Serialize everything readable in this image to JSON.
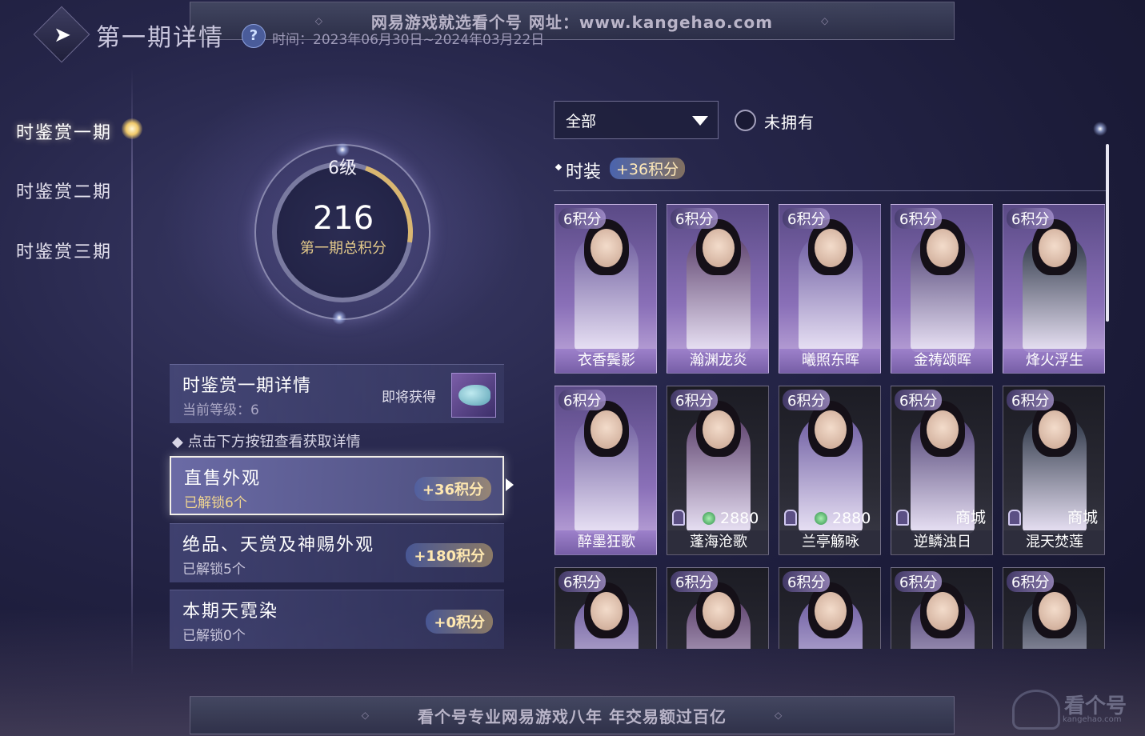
{
  "header": {
    "title": "第一期详情",
    "time_text": "时间：2023年06月30日~2024年03月22日",
    "help": "?"
  },
  "watermark": {
    "top_text": "网易游戏就选看个号  网址：www.kangehao.com",
    "bottom_text": "看个号专业网易游戏八年  年交易额过百亿",
    "logo_text": "看个号",
    "logo_sub": "kangehao.com"
  },
  "nav": {
    "items": [
      {
        "label": "时鉴赏一期",
        "active": true
      },
      {
        "label": "时鉴赏二期",
        "active": false
      },
      {
        "label": "时鉴赏三期",
        "active": false
      }
    ]
  },
  "progress": {
    "level": "6级",
    "score": "216",
    "caption": "第一期总积分"
  },
  "detail": {
    "title": "时鉴赏一期详情",
    "current_level": "当前等级：6",
    "soon_label": "即将获得"
  },
  "hint": "点击下方按钮查看获取详情",
  "categories": [
    {
      "name": "直售外观",
      "unlocked": "已解锁6个",
      "points": "+36积分",
      "active": true
    },
    {
      "name": "绝品、天赏及神赐外观",
      "unlocked": "已解锁5个",
      "points": "+180积分",
      "active": false
    },
    {
      "name": "本期天霓染",
      "unlocked": "已解锁0个",
      "points": "+0积分",
      "active": false
    }
  ],
  "filters": {
    "select_value": "全部",
    "radio_label": "未拥有"
  },
  "section": {
    "title": "时装",
    "points": "+36积分"
  },
  "cards": [
    {
      "points": "6积分",
      "name": "衣香鬓影",
      "style": "light"
    },
    {
      "points": "6积分",
      "name": "瀚渊龙炎",
      "style": "light"
    },
    {
      "points": "6积分",
      "name": "曦照东晖",
      "style": "light"
    },
    {
      "points": "6积分",
      "name": "金祷颂晖",
      "style": "light"
    },
    {
      "points": "6积分",
      "name": "烽火浮生",
      "style": "light"
    },
    {
      "points": "6积分",
      "name": "醉墨狂歌",
      "style": "light"
    },
    {
      "points": "6积分",
      "name": "蓬海沧歌",
      "style": "dark",
      "price": "2880"
    },
    {
      "points": "6积分",
      "name": "兰亭觞咏",
      "style": "dark",
      "price": "2880"
    },
    {
      "points": "6积分",
      "name": "逆鳞浊日",
      "style": "dark",
      "shop": "商城"
    },
    {
      "points": "6积分",
      "name": "混天焚莲",
      "style": "dark",
      "shop": "商城"
    },
    {
      "points": "6积分",
      "name": "",
      "style": "dark"
    },
    {
      "points": "6积分",
      "name": "",
      "style": "dark"
    },
    {
      "points": "6积分",
      "name": "",
      "style": "dark"
    },
    {
      "points": "6积分",
      "name": "",
      "style": "dark"
    },
    {
      "points": "6积分",
      "name": "",
      "style": "dark"
    }
  ],
  "colors": {
    "accent_gold": "#d9b671",
    "points_text": "#ffe8b0",
    "background": "#26264a"
  }
}
